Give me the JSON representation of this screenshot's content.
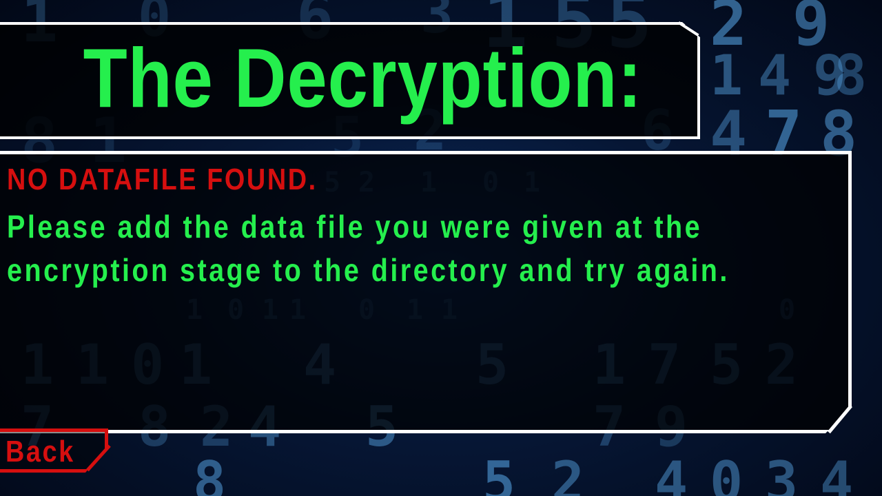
{
  "screen": {
    "title": "The Decryption:",
    "error_message": "NO DATAFILE FOUND.",
    "instruction": "Please add the data file you were given at the encryption stage to the directory and try again.",
    "back_label": "Back"
  },
  "colors": {
    "title_green": "#25ef4d",
    "error_red": "#d60f0f",
    "panel_border": "#ffffff",
    "background_blue": "#061634"
  },
  "background": {
    "digits": [
      "1",
      "0",
      "6",
      "3",
      "1",
      "5",
      "5",
      "2",
      "9",
      "1",
      "4",
      "9",
      "8",
      "8",
      "1",
      "5",
      "2",
      "6",
      "4",
      "7",
      "8",
      "5",
      "2",
      "1",
      "0",
      "1",
      "1",
      "0",
      "1",
      "1",
      "0",
      "1",
      "1",
      "0",
      "1",
      "1",
      "0",
      "1",
      "4",
      "5",
      "1",
      "7",
      "5",
      "2",
      "7",
      "8",
      "2",
      "4",
      "5",
      "7",
      "9",
      "8",
      "5",
      "2",
      "4",
      "0",
      "3",
      "4",
      "0",
      "6",
      "7"
    ]
  }
}
